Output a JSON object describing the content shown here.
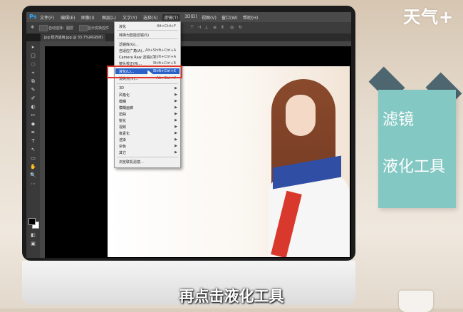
{
  "decor": {
    "brand": "天气+",
    "note_title": "滤镜",
    "note_sub": "液化工具",
    "subtitle": "再点击液化工具"
  },
  "ps": {
    "logo": "Ps",
    "menu": [
      "文件(F)",
      "编辑(E)",
      "图像(I)",
      "图层(L)",
      "文字(Y)",
      "选择(S)",
      "滤镜(T)",
      "3D(D)",
      "视图(V)",
      "窗口(W)",
      "帮助(H)"
    ],
    "active_menu": "滤镜(T)",
    "options": {
      "auto_select": "自动选择：",
      "layer_value": "图层",
      "show_transform": "显示变换控件"
    },
    "doc_tab": "jpg 经济适用.jpg @ 33.7%(RGB/8)",
    "tools": [
      "▸",
      "▢",
      "◌",
      "⌖",
      "⧉",
      "✎",
      "✐",
      "◐",
      "✂",
      "◆",
      "✒",
      "T",
      "↖",
      "▭",
      "✋",
      "🔍",
      "⋯",
      "◧",
      "▣"
    ]
  },
  "filter_menu": {
    "items": [
      {
        "label": "液化",
        "shortcut": "Alt+Ctrl+F"
      },
      {
        "label": "转换为智能滤镜(S)",
        "shortcut": ""
      },
      {
        "label": "滤镜库(G)...",
        "shortcut": ""
      },
      {
        "label": "自适应广角(A)...",
        "shortcut": "Alt+Shift+Ctrl+A"
      },
      {
        "label": "Camera Raw 滤镜(C)...",
        "shortcut": "Shift+Ctrl+A"
      },
      {
        "label": "镜头校正(R)...",
        "shortcut": "Shift+Ctrl+R"
      },
      {
        "label": "液化(L)...",
        "shortcut": "Shift+Ctrl+X"
      },
      {
        "label": "消失点(V)...",
        "shortcut": "Alt+Ctrl+V"
      }
    ],
    "submenus": [
      "3D",
      "风格化",
      "模糊",
      "模糊画廊",
      "扭曲",
      "锐化",
      "视频",
      "像素化",
      "渲染",
      "杂色",
      "其它"
    ],
    "bottom": "浏览联机滤镜..."
  }
}
